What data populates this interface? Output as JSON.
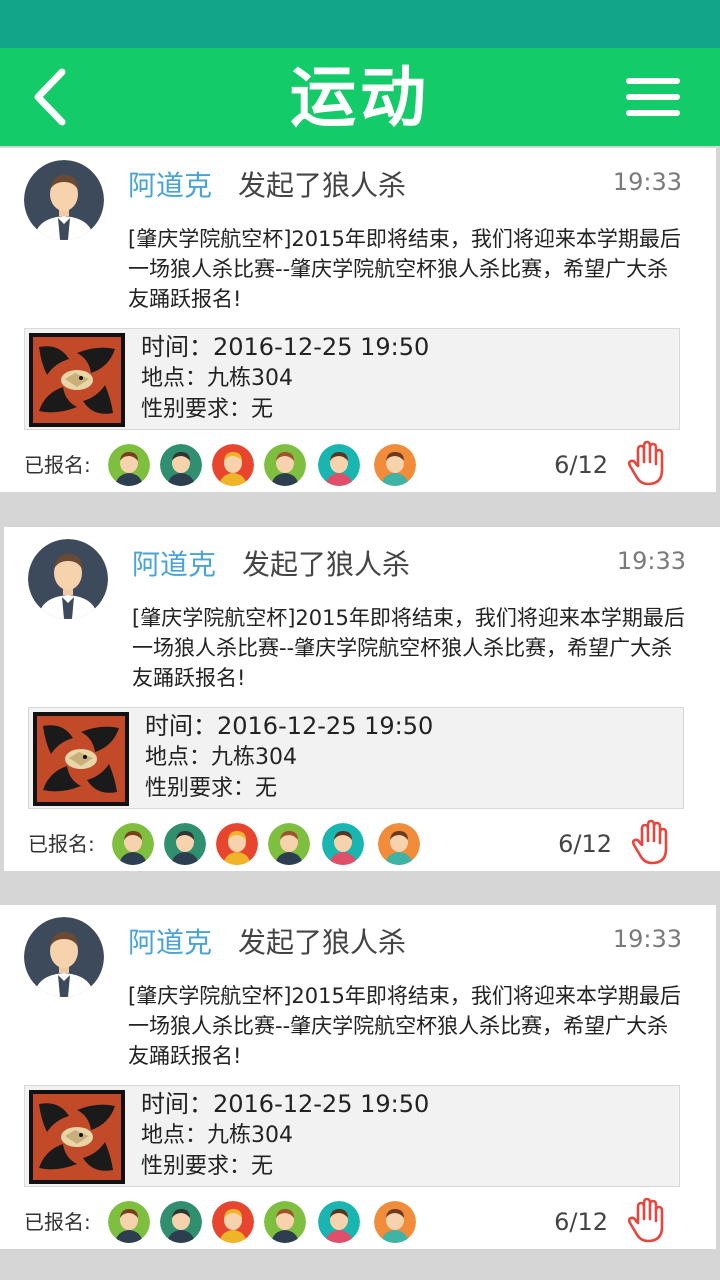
{
  "header": {
    "title": "运动"
  },
  "registered_label": "已报名:",
  "posts": [
    {
      "author": "阿道克",
      "action": "发起了狼人杀",
      "time": "19:33",
      "description": "[肇庆学院航空杯]2015年即将结束，我们将迎来本学期最后一场狼人杀比赛--肇庆学院航空杯狼人杀比赛，希望广大杀友踊跃报名!",
      "event": {
        "time": "时间：2016-12-25 19:50",
        "place": "地点：九栋304",
        "gender": "性别要求：无"
      },
      "count": "6/12"
    },
    {
      "author": "阿道克",
      "action": "发起了狼人杀",
      "time": "19:33",
      "description": "[肇庆学院航空杯]2015年即将结束，我们将迎来本学期最后一场狼人杀比赛--肇庆学院航空杯狼人杀比赛，希望广大杀友踊跃报名!",
      "event": {
        "time": "时间：2016-12-25 19:50",
        "place": "地点：九栋304",
        "gender": "性别要求：无"
      },
      "count": "6/12"
    },
    {
      "author": "阿道克",
      "action": "发起了狼人杀",
      "time": "19:33",
      "description": "[肇庆学院航空杯]2015年即将结束，我们将迎来本学期最后一场狼人杀比赛--肇庆学院航空杯狼人杀比赛，希望广大杀友踊跃报名!",
      "event": {
        "time": "时间：2016-12-25 19:50",
        "place": "地点：九栋304",
        "gender": "性别要求：无"
      },
      "count": "6/12"
    }
  ],
  "colors": {
    "status_bar": "#12a58a",
    "header": "#13cb68",
    "author": "#4aa3d6",
    "hand_icon": "#e8463c"
  },
  "icons": {
    "back": "chevron-left-icon",
    "menu": "hamburger-menu-icon",
    "join": "raised-hand-icon"
  }
}
